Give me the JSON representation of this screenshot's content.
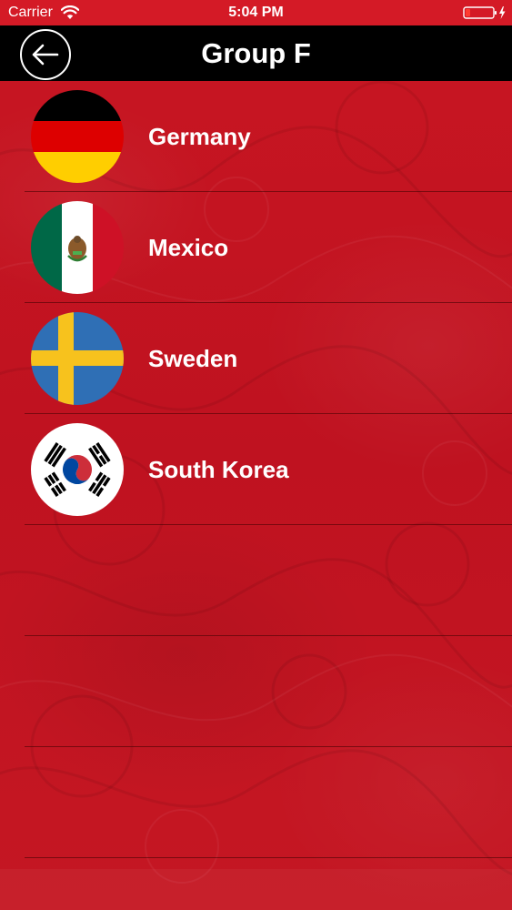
{
  "status_bar": {
    "carrier": "Carrier",
    "time": "5:04 PM"
  },
  "nav": {
    "title": "Group F",
    "back_icon": "back-arrow-icon"
  },
  "teams": [
    {
      "name": "Germany",
      "flag_icon": "germany-flag-icon"
    },
    {
      "name": "Mexico",
      "flag_icon": "mexico-flag-icon"
    },
    {
      "name": "Sweden",
      "flag_icon": "sweden-flag-icon"
    },
    {
      "name": "South Korea",
      "flag_icon": "south-korea-flag-icon"
    }
  ],
  "colors": {
    "background": "#c51420",
    "nav_bar": "#000000",
    "text": "#ffffff",
    "battery_low": "#ff3b30"
  }
}
